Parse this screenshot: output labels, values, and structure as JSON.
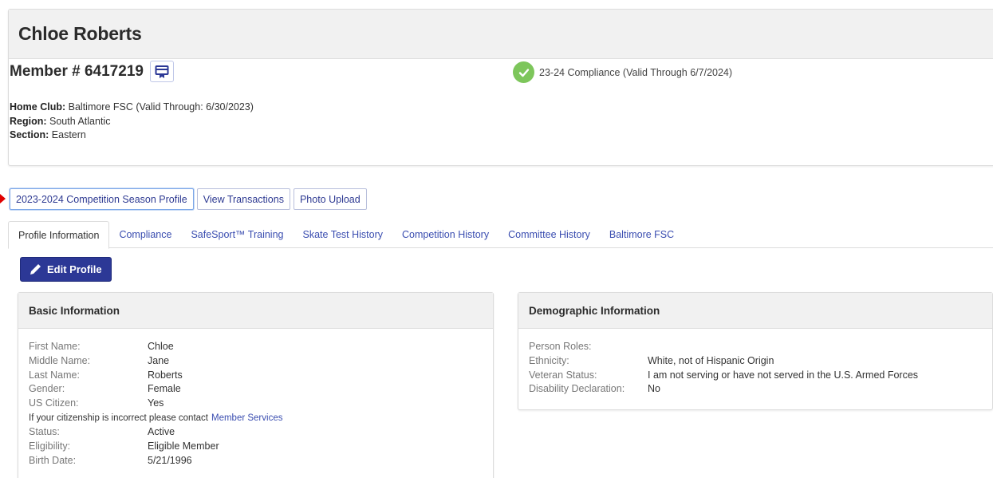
{
  "member": {
    "name": "Chloe Roberts",
    "number_label": "Member # 6417219",
    "compliance_text": "23-24 Compliance (Valid Through 6/7/2024)",
    "home_club_label": "Home Club:",
    "home_club_value": "Baltimore FSC (Valid Through: 6/30/2023)",
    "region_label": "Region:",
    "region_value": "South Atlantic",
    "section_label": "Section:",
    "section_value": "Eastern"
  },
  "actions": {
    "season_profile": "2023-2024 Competition Season Profile",
    "view_transactions": "View Transactions",
    "photo_upload": "Photo Upload"
  },
  "tabs": [
    {
      "label": "Profile Information"
    },
    {
      "label": "Compliance"
    },
    {
      "label": "SafeSport™ Training"
    },
    {
      "label": "Skate Test History"
    },
    {
      "label": "Competition History"
    },
    {
      "label": "Committee History"
    },
    {
      "label": "Baltimore FSC"
    }
  ],
  "edit_profile_label": "Edit Profile",
  "basic": {
    "title": "Basic Information",
    "rows": [
      {
        "label": "First Name:",
        "value": "Chloe"
      },
      {
        "label": "Middle Name:",
        "value": "Jane"
      },
      {
        "label": "Last Name:",
        "value": "Roberts"
      },
      {
        "label": "Gender:",
        "value": "Female"
      },
      {
        "label": "US Citizen:",
        "value": "Yes"
      }
    ],
    "citizen_note": "If your citizenship is incorrect please contact",
    "member_services_link": "Member Services",
    "rows2": [
      {
        "label": "Status:",
        "value": "Active"
      },
      {
        "label": "Eligibility:",
        "value": "Eligible Member"
      },
      {
        "label": "Birth Date:",
        "value": "5/21/1996"
      }
    ]
  },
  "demographic": {
    "title": "Demographic Information",
    "rows": [
      {
        "label": "Person Roles:",
        "value": ""
      },
      {
        "label": "Ethnicity:",
        "value": "White, not of Hispanic Origin"
      },
      {
        "label": "Veteran Status:",
        "value": "I am not serving or have not served in the U.S. Armed Forces"
      },
      {
        "label": "Disability Declaration:",
        "value": "No"
      }
    ]
  },
  "colors": {
    "brand_blue": "#2c3896",
    "link_blue": "#3a4db0",
    "compliance_green": "#7dc65b",
    "marker_red": "#e00000"
  },
  "icons": {
    "membership_card": "membership-card-icon",
    "compliance_check": "check-circle-icon",
    "edit": "pencil-icon"
  }
}
